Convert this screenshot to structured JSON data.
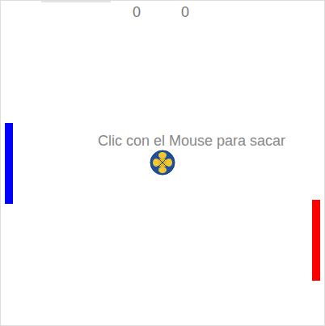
{
  "scores": [
    "0",
    "0"
  ],
  "message": "Clic con el Mouse para sacar",
  "paddles": [
    {
      "side": "left",
      "color": "#0000ff"
    },
    {
      "side": "right",
      "color": "#ff0000"
    }
  ]
}
